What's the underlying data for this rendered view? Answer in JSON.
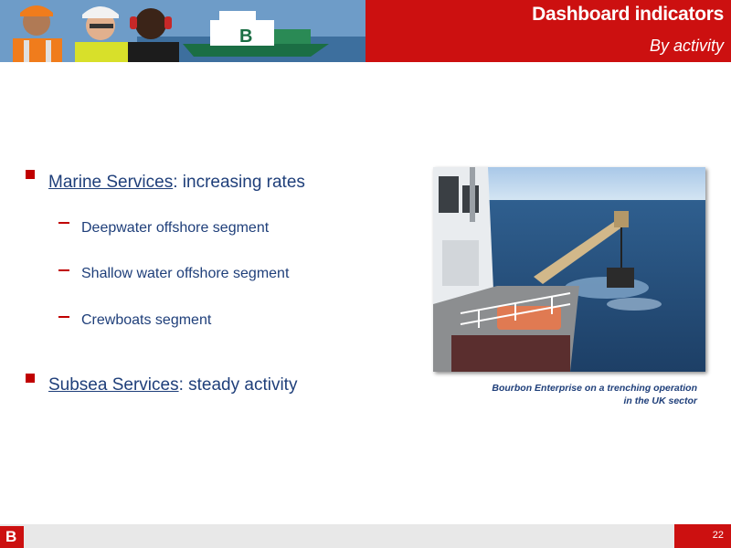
{
  "header": {
    "title": "Dashboard indicators",
    "subtitle": "By activity",
    "accent_color": "#cc1010"
  },
  "content": {
    "items": [
      {
        "link_text": "Marine Services",
        "suffix": ": increasing rates",
        "subitems": [
          "Deepwater offshore segment",
          "Shallow water offshore segment",
          "Crewboats segment"
        ]
      },
      {
        "link_text": "Subsea Services",
        "suffix": ": steady activity",
        "subitems": []
      }
    ]
  },
  "photo": {
    "caption_line1": "Bourbon Enterprise on a trenching operation",
    "caption_line2": "in the UK sector"
  },
  "footer": {
    "logo_letter": "B",
    "page_number": "22"
  }
}
